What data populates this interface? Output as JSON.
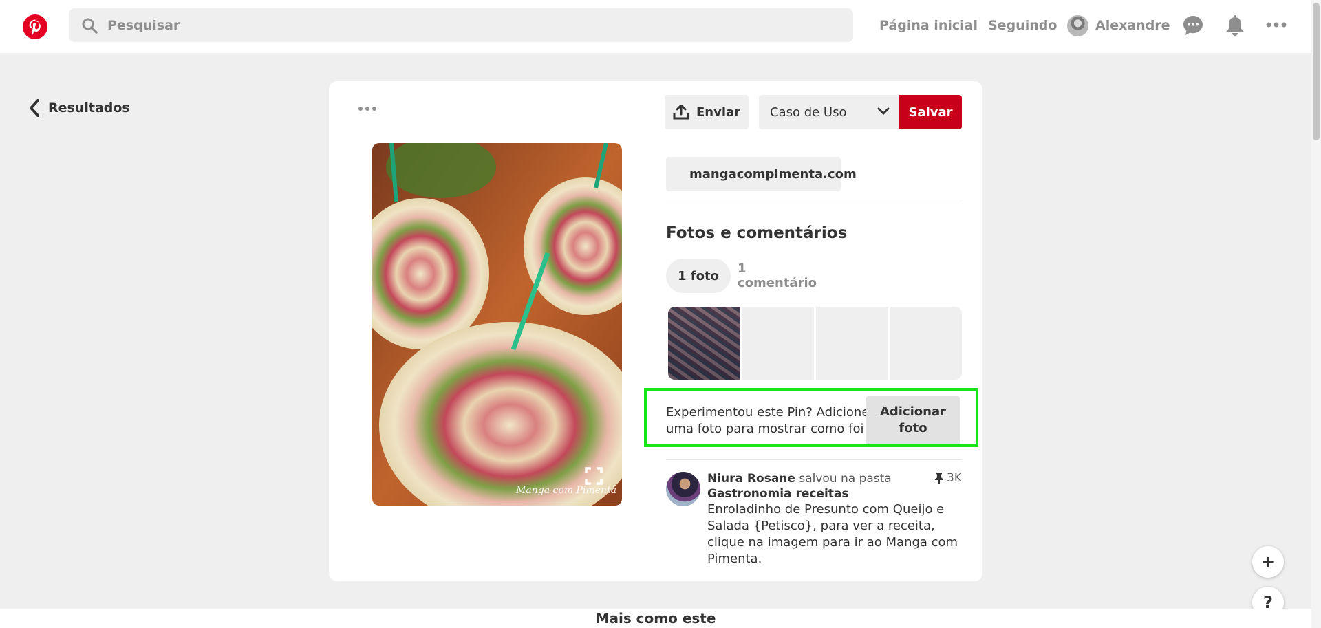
{
  "header": {
    "search_placeholder": "Pesquisar",
    "nav_home": "Página inicial",
    "nav_following": "Seguindo",
    "user_name": "Alexandre",
    "brand_color": "#e60023"
  },
  "back": {
    "label": "Resultados"
  },
  "pin": {
    "watermark": "Manga com Pimenta",
    "send_label": "Enviar",
    "board_selected": "Caso de Uso",
    "save_label": "Salvar",
    "source_link": "mangacompimenta.com"
  },
  "photos_section": {
    "title": "Fotos e comentários",
    "tabs": [
      {
        "label": "1 foto",
        "active": true
      },
      {
        "label": "1 comentário",
        "active": false
      }
    ]
  },
  "try_cta": {
    "text": "Experimentou este Pin? Adicione uma foto para mostrar como foi",
    "button_label": "Adicionar foto",
    "highlight_color": "#19e619"
  },
  "saver": {
    "name": "Niura Rosane",
    "action": "salvou na pasta",
    "board": "Gastronomia receitas",
    "save_count": "3K",
    "description": "Enroladinho de Presunto com Queijo e Salada {Petisco}, para ver a receita, clique na imagem para ir ao Manga com Pimenta."
  },
  "fab": {
    "plus": "+",
    "help": "?"
  },
  "footer": {
    "more_like_this": "Mais como este"
  }
}
